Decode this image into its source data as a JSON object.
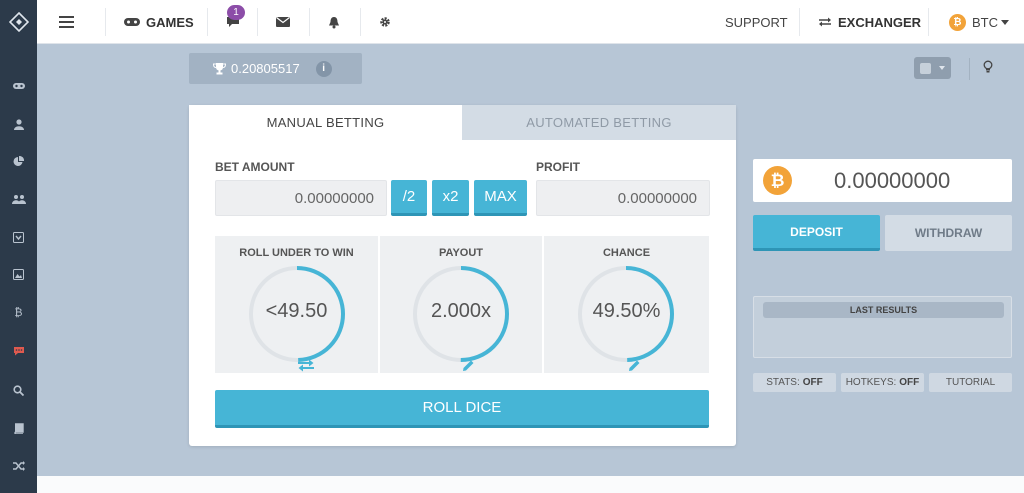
{
  "sidebar": {
    "logo": "logo-diamond",
    "items": [
      {
        "name": "games",
        "icon": "gamepad"
      },
      {
        "name": "user",
        "icon": "user"
      },
      {
        "name": "stats",
        "icon": "pie-chart"
      },
      {
        "name": "friends",
        "icon": "users"
      },
      {
        "name": "inbox",
        "icon": "inbox"
      },
      {
        "name": "images",
        "icon": "image"
      },
      {
        "name": "bitcoin",
        "icon": "bitcoin"
      },
      {
        "name": "chat",
        "icon": "chat"
      },
      {
        "name": "search",
        "icon": "search"
      },
      {
        "name": "book",
        "icon": "book"
      },
      {
        "name": "shuffle",
        "icon": "shuffle"
      }
    ]
  },
  "topbar": {
    "games_label": "GAMES",
    "chat_badge": "1",
    "support_label": "SUPPORT",
    "exchanger_label": "EXCHANGER",
    "currency_label": "BTC",
    "currency_symbol": "₿"
  },
  "trophy": {
    "value": "0.20805517",
    "info": "i"
  },
  "tabs": {
    "manual": "MANUAL BETTING",
    "automated": "AUTOMATED BETTING"
  },
  "bet": {
    "amount_label": "BET AMOUNT",
    "amount_value": "0.00000000",
    "half_label": "/2",
    "double_label": "x2",
    "max_label": "MAX",
    "profit_label": "PROFIT",
    "profit_value": "0.00000000"
  },
  "stats": {
    "roll_title": "ROLL UNDER TO WIN",
    "roll_value": "<49.50",
    "payout_title": "PAYOUT",
    "payout_value": "2.000x",
    "chance_title": "CHANCE",
    "chance_value": "49.50%",
    "roll_fraction": 0.495,
    "payout_fraction": 0.5,
    "chance_fraction": 0.495
  },
  "roll_button": "ROLL DICE",
  "wallet": {
    "balance": "0.00000000",
    "coin_symbol": "₿",
    "deposit": "DEPOSIT",
    "withdraw": "WITHDRAW",
    "last_results": "LAST RESULTS"
  },
  "toggles": {
    "stats_label": "STATS:",
    "stats_value": "OFF",
    "hotkeys_label": "HOTKEYS:",
    "hotkeys_value": "OFF",
    "tutorial": "TUTORIAL"
  },
  "colors": {
    "accent": "#46b5d6",
    "sidebar": "#2c3a4a",
    "background": "#b7c6d6",
    "bitcoin": "#f2a339",
    "badge": "#8c4da8"
  }
}
